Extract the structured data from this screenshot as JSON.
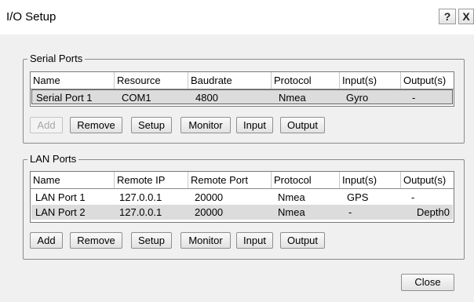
{
  "window": {
    "title": "I/O Setup",
    "help_label": "?",
    "close_label": "X"
  },
  "serial": {
    "legend": "Serial Ports",
    "columns": [
      "Name",
      "Resource",
      "Baudrate",
      "Protocol",
      "Input(s)",
      "Output(s)"
    ],
    "rows": [
      [
        "Serial Port 1",
        "COM1",
        "4800",
        "Nmea",
        "Gyro",
        "-"
      ]
    ],
    "buttons": {
      "add": "Add",
      "remove": "Remove",
      "setup": "Setup",
      "monitor": "Monitor",
      "input": "Input",
      "output": "Output"
    }
  },
  "lan": {
    "legend": "LAN Ports",
    "columns": [
      "Name",
      "Remote IP",
      "Remote Port",
      "Protocol",
      "Input(s)",
      "Output(s)"
    ],
    "rows": [
      [
        "LAN Port 1",
        "127.0.0.1",
        "20000",
        "Nmea",
        "GPS",
        "-"
      ],
      [
        "LAN Port 2",
        "127.0.0.1",
        "20000",
        "Nmea",
        "-",
        "Depth0"
      ]
    ],
    "buttons": {
      "add": "Add",
      "remove": "Remove",
      "setup": "Setup",
      "monitor": "Monitor",
      "input": "Input",
      "output": "Output"
    }
  },
  "footer": {
    "close_label": "Close"
  }
}
